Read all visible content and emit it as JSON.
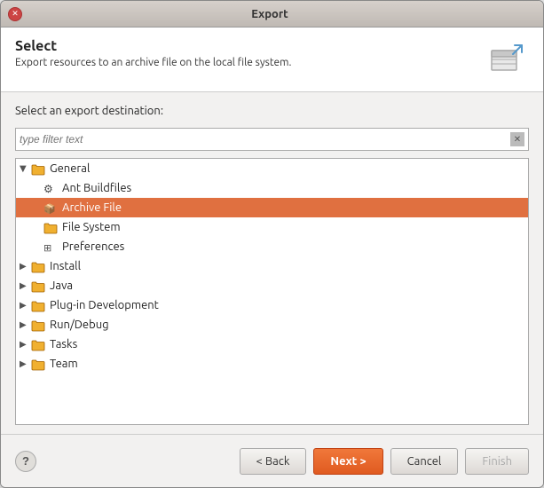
{
  "titlebar": {
    "title": "Export",
    "close_label": "✕"
  },
  "header": {
    "title": "Select",
    "description": "Export resources to an archive file on the local file system."
  },
  "body": {
    "label": "Select an export destination:",
    "filter_placeholder": "type filter text",
    "tree": [
      {
        "id": "general",
        "label": "General",
        "indent": 0,
        "arrow": "▼",
        "type": "folder",
        "selected": false
      },
      {
        "id": "ant-buildfiles",
        "label": "Ant Buildfiles",
        "indent": 1,
        "arrow": "",
        "type": "special-ant",
        "selected": false
      },
      {
        "id": "archive-file",
        "label": "Archive File",
        "indent": 1,
        "arrow": "",
        "type": "special-archive",
        "selected": true
      },
      {
        "id": "file-system",
        "label": "File System",
        "indent": 1,
        "arrow": "",
        "type": "folder",
        "selected": false
      },
      {
        "id": "preferences",
        "label": "Preferences",
        "indent": 1,
        "arrow": "",
        "type": "special-pref",
        "selected": false
      },
      {
        "id": "install",
        "label": "Install",
        "indent": 0,
        "arrow": "▶",
        "type": "folder",
        "selected": false
      },
      {
        "id": "java",
        "label": "Java",
        "indent": 0,
        "arrow": "▶",
        "type": "folder",
        "selected": false
      },
      {
        "id": "plugin-dev",
        "label": "Plug-in Development",
        "indent": 0,
        "arrow": "▶",
        "type": "folder",
        "selected": false
      },
      {
        "id": "run-debug",
        "label": "Run/Debug",
        "indent": 0,
        "arrow": "▶",
        "type": "folder",
        "selected": false
      },
      {
        "id": "tasks",
        "label": "Tasks",
        "indent": 0,
        "arrow": "▶",
        "type": "folder",
        "selected": false
      },
      {
        "id": "team",
        "label": "Team",
        "indent": 0,
        "arrow": "▶",
        "type": "folder",
        "selected": false
      }
    ]
  },
  "footer": {
    "help_label": "?",
    "back_label": "< Back",
    "next_label": "Next >",
    "cancel_label": "Cancel",
    "finish_label": "Finish"
  }
}
